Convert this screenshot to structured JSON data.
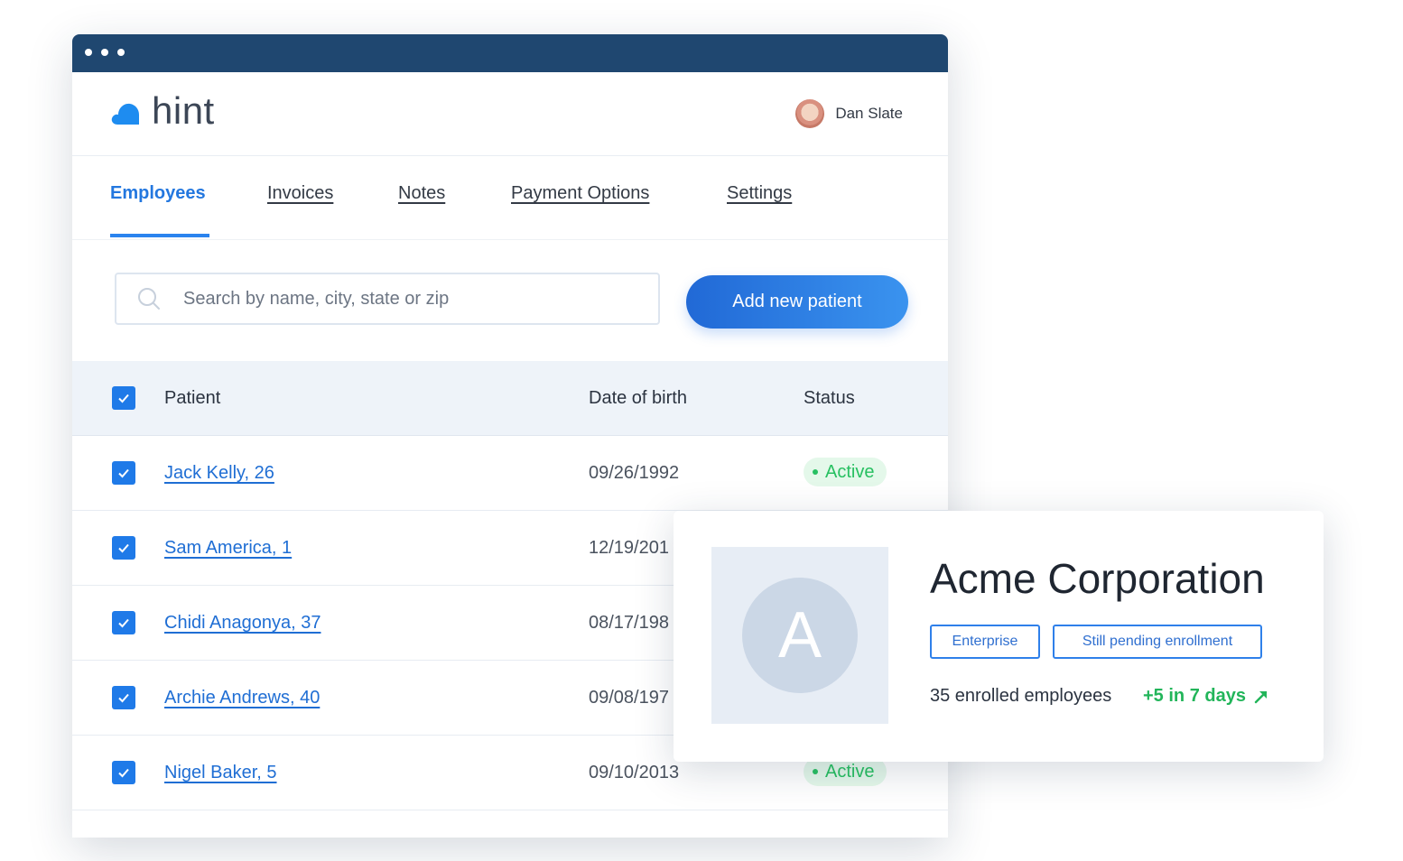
{
  "app": {
    "logo_text": "hint",
    "user_name": "Dan Slate"
  },
  "tabs": [
    {
      "label": "Employees",
      "active": true
    },
    {
      "label": "Invoices",
      "active": false
    },
    {
      "label": "Notes",
      "active": false
    },
    {
      "label": "Payment Options",
      "active": false
    },
    {
      "label": "Settings",
      "active": false
    }
  ],
  "search": {
    "placeholder": "Search by name, city, state or zip",
    "value": ""
  },
  "add_button_label": "Add new patient",
  "table": {
    "headers": {
      "patient": "Patient",
      "dob": "Date of birth",
      "status": "Status"
    },
    "header_checked": true,
    "rows": [
      {
        "patient": "Jack Kelly, 26",
        "dob": "09/26/1992",
        "status": "Active",
        "checked": true
      },
      {
        "patient": "Sam America, 1",
        "dob": "12/19/201",
        "status": "",
        "checked": true
      },
      {
        "patient": "Chidi Anagonya, 37",
        "dob": "08/17/198",
        "status": "",
        "checked": true
      },
      {
        "patient": "Archie Andrews, 40",
        "dob": "09/08/197",
        "status": "",
        "checked": true
      },
      {
        "patient": "Nigel Baker, 5",
        "dob": "09/10/2013",
        "status": "Active",
        "checked": true
      }
    ]
  },
  "company_card": {
    "initial": "A",
    "name": "Acme Corporation",
    "tags": [
      "Enterprise",
      "Still pending enrollment"
    ],
    "enrolled_text": "35 enrolled employees",
    "growth_text": "+5 in 7 days"
  },
  "colors": {
    "titlebar": "#1f4770",
    "accent": "#2a83ee",
    "active_green": "#27c061",
    "link": "#1f6ed4"
  },
  "icons": {
    "logo": "cloud-logo-icon",
    "search": "search-icon",
    "checkbox": "checkmark-icon",
    "trend": "trend-up-arrow-icon"
  }
}
